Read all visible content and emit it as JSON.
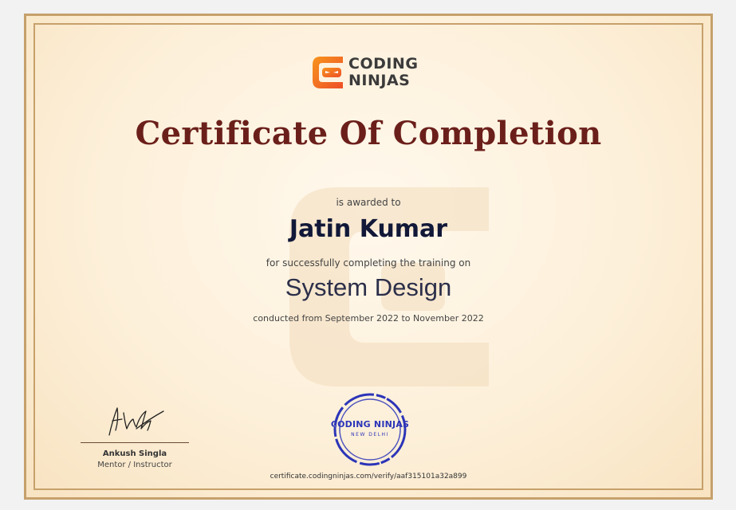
{
  "logo": {
    "line1": "CODING",
    "line2": "NINJAS"
  },
  "certificate": {
    "title": "Certificate Of Completion",
    "awarded_to_label": "is awarded to",
    "recipient_name": "Jatin Kumar",
    "completion_label": "for successfully completing the training on",
    "course_name": "System Design",
    "conducted_text": "conducted from September 2022 to November 2022"
  },
  "signatory": {
    "name": "Ankush Singla",
    "role": "Mentor / Instructor"
  },
  "stamp": {
    "title": "CODING NINJAS",
    "subtitle": "NEW DELHI"
  },
  "verification": {
    "url_text": "certificate.codingninjas.com/verify/aaf315101a32a899"
  },
  "colors": {
    "title": "#6b1f1a",
    "accent_orange": "#f0692a",
    "stamp_blue": "#2c35b8",
    "border_gold": "#c6a06b",
    "background": "#fdf0da"
  },
  "icons": {
    "logo_mark": "coding-ninjas-logo-icon",
    "signature": "signature-icon",
    "watermark": "watermark-logo-icon"
  }
}
